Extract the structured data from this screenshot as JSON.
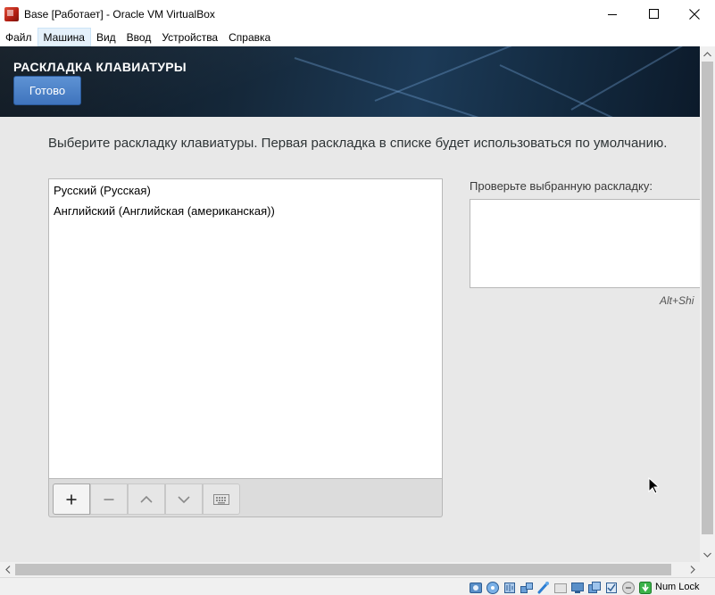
{
  "window": {
    "title": "Base [Работает] - Oracle VM VirtualBox",
    "icon": "virtualbox-app-icon"
  },
  "menu": {
    "items": [
      {
        "label": "Файл",
        "active": false
      },
      {
        "label": "Машина",
        "active": true
      },
      {
        "label": "Вид",
        "active": false
      },
      {
        "label": "Ввод",
        "active": false
      },
      {
        "label": "Устройства",
        "active": false
      },
      {
        "label": "Справка",
        "active": false
      }
    ]
  },
  "installer": {
    "screen_title": "РАСКЛАДКА КЛАВИАТУРЫ",
    "done_button": "Готово",
    "instruction": "Выберите раскладку клавиатуры. Первая раскладка в списке будет использоваться по умолчанию.",
    "layouts": [
      "Русский (Русская)",
      "Английский (Английская (американская))"
    ],
    "toolbar": {
      "add": "+",
      "remove": "−",
      "icons": [
        "plus-icon",
        "minus-icon",
        "chevron-up-icon",
        "chevron-down-icon",
        "keyboard-icon"
      ]
    },
    "preview_label": "Проверьте выбранную раскладку:",
    "preview_value": "",
    "shortcut_hint": "Alt+Shi"
  },
  "statusbar": {
    "indicator": "Num Lock",
    "icons": [
      "hard-disk-icon",
      "optical-drive-icon",
      "audio-icon",
      "network-icon",
      "usb-icon",
      "shared-folders-icon",
      "display-icon",
      "recording-icon",
      "cpu-icon",
      "mouse-integration-icon",
      "host-key-icon"
    ]
  },
  "colors": {
    "accent_button": "#4a7fc6",
    "header_dark": "#15283a",
    "menu_active": "#e5f1fb"
  }
}
